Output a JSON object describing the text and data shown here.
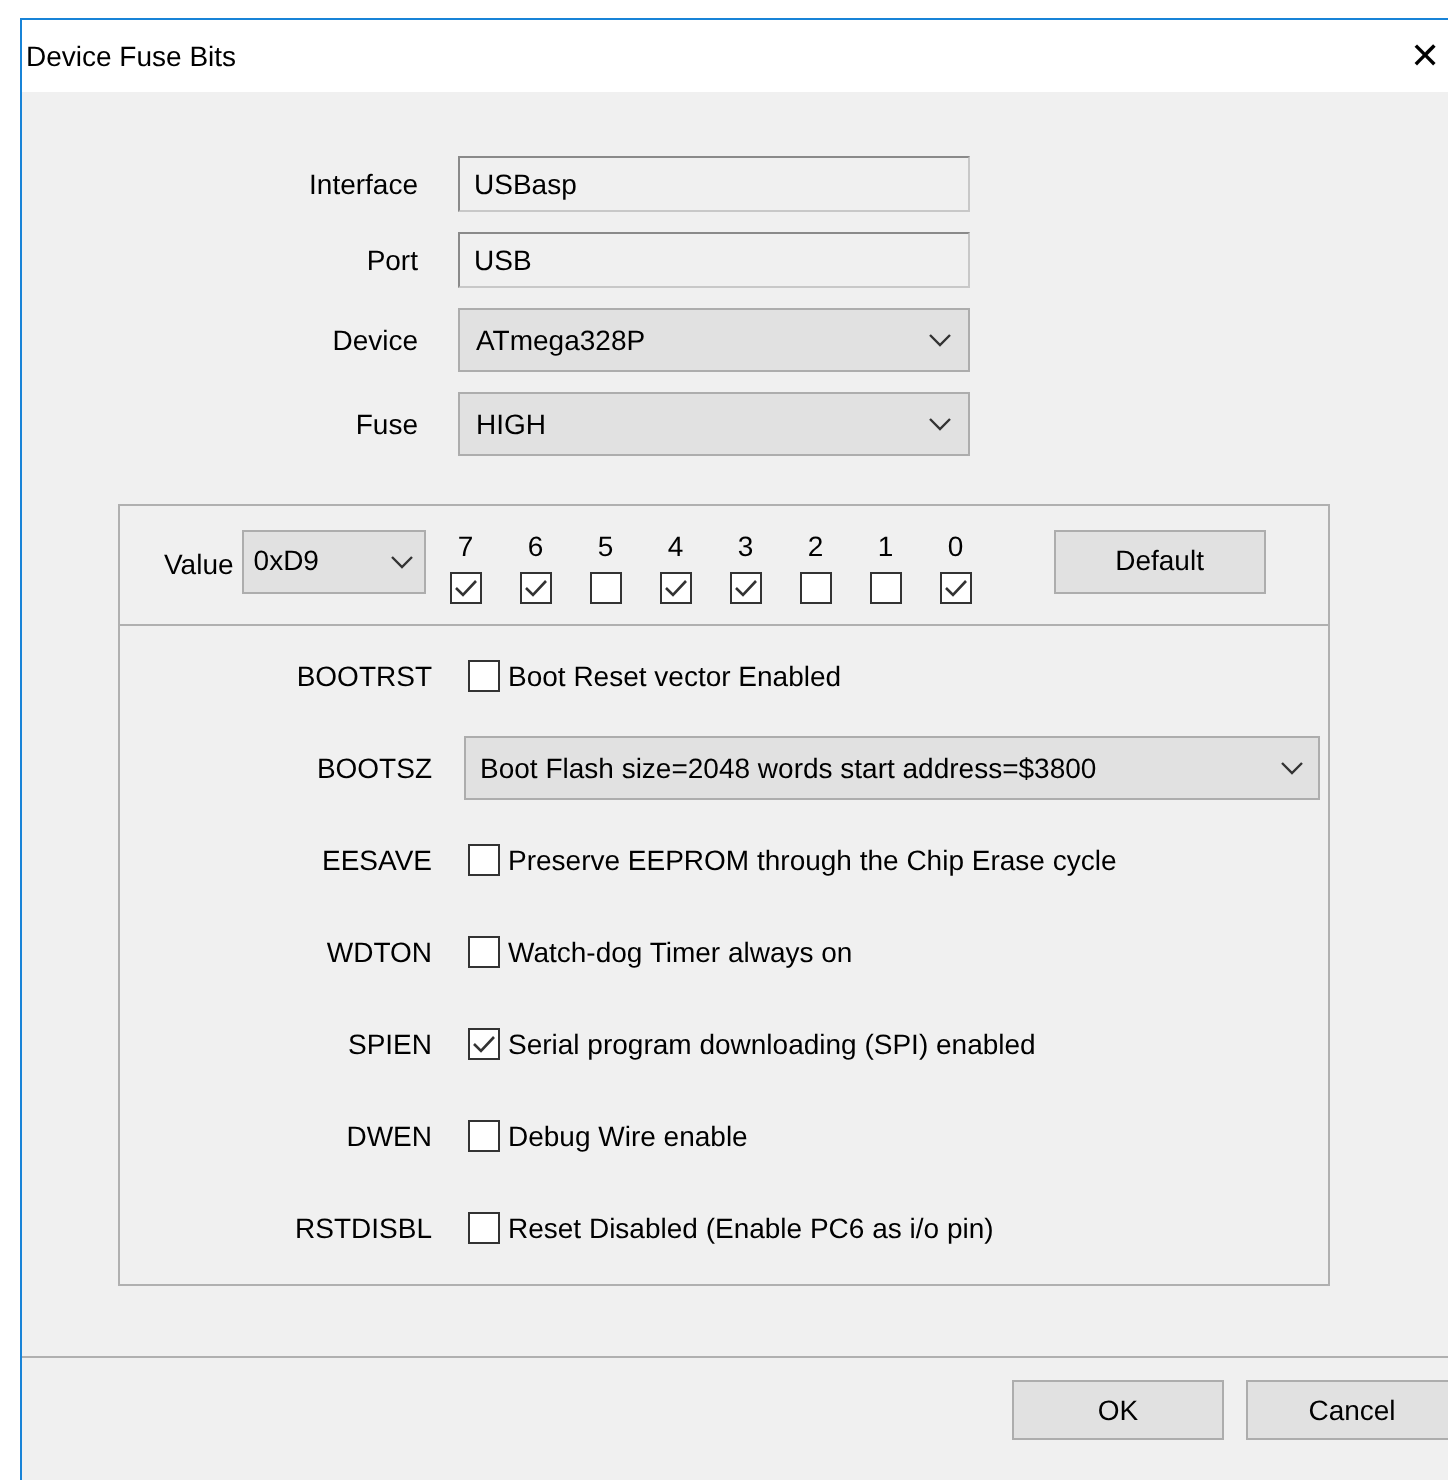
{
  "window": {
    "title": "Device Fuse Bits",
    "close": "✕"
  },
  "fields": [
    {
      "kind": "text",
      "label": "Interface",
      "value": "USBasp"
    },
    {
      "kind": "text",
      "label": "Port",
      "value": "USB"
    },
    {
      "kind": "combo",
      "label": "Device",
      "value": "ATmega328P"
    },
    {
      "kind": "combo",
      "label": "Fuse",
      "value": "HIGH"
    }
  ],
  "value": {
    "label": "Value",
    "value": "0xD9"
  },
  "bits": [
    {
      "label": "7",
      "checked": true
    },
    {
      "label": "6",
      "checked": true
    },
    {
      "label": "5",
      "checked": false
    },
    {
      "label": "4",
      "checked": true
    },
    {
      "label": "3",
      "checked": true
    },
    {
      "label": "2",
      "checked": false
    },
    {
      "label": "1",
      "checked": false
    },
    {
      "label": "0",
      "checked": true
    }
  ],
  "default_button": "Default",
  "options": [
    {
      "kind": "check",
      "name": "BOOTRST",
      "text": "Boot Reset vector Enabled",
      "checked": false
    },
    {
      "kind": "combo",
      "name": "BOOTSZ",
      "text": "Boot Flash size=2048 words start address=$3800"
    },
    {
      "kind": "check",
      "name": "EESAVE",
      "text": "Preserve EEPROM through the Chip Erase cycle",
      "checked": false
    },
    {
      "kind": "check",
      "name": "WDTON",
      "text": "Watch-dog Timer always on",
      "checked": false
    },
    {
      "kind": "check",
      "name": "SPIEN",
      "text": "Serial program downloading (SPI) enabled",
      "checked": true
    },
    {
      "kind": "check",
      "name": "DWEN",
      "text": "Debug Wire enable",
      "checked": false
    },
    {
      "kind": "check",
      "name": "RSTDISBL",
      "text": "Reset Disabled (Enable PC6 as i/o pin)",
      "checked": false
    }
  ],
  "buttons": [
    "OK",
    "Cancel"
  ]
}
